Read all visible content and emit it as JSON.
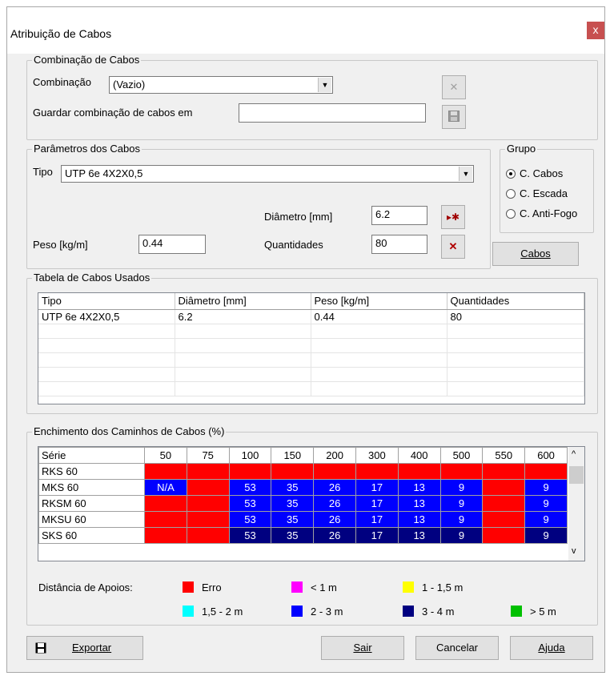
{
  "window": {
    "title": "Atribuição de Cabos",
    "close_glyph": "x"
  },
  "combination_group": {
    "title": "Combinação de Cabos",
    "combination_label": "Combinação",
    "combination_value": "(Vazio)",
    "save_label": "Guardar combinação de cabos em",
    "save_value": ""
  },
  "params_group": {
    "title": "Parâmetros dos Cabos",
    "type_label": "Tipo",
    "type_value": "UTP 6e 4X2X0,5",
    "diameter_label": "Diâmetro [mm]",
    "diameter_value": "6.2",
    "weight_label": "Peso [kg/m]",
    "weight_value": "0.44",
    "quantity_label": "Quantidades",
    "quantity_value": "80"
  },
  "group_box": {
    "title": "Grupo",
    "options": [
      "C. Cabos",
      "C. Escada",
      "C. Anti-Fogo"
    ],
    "selected": "C. Cabos",
    "cabos_button": "Cabos"
  },
  "used_table": {
    "title": "Tabela de Cabos Usados",
    "headers": [
      "Tipo",
      "Diâmetro [mm]",
      "Peso [kg/m]",
      "Quantidades"
    ],
    "rows": [
      [
        "UTP 6e 4X2X0,5",
        "6.2",
        "0.44",
        "80"
      ]
    ]
  },
  "fill_table": {
    "title": "Enchimento dos Caminhos de Cabos (%)",
    "headers": [
      "Série",
      "50",
      "75",
      "100",
      "150",
      "200",
      "300",
      "400",
      "500",
      "550",
      "600"
    ],
    "rows": [
      {
        "name": "RKS 60",
        "cells": [
          [
            "",
            "red"
          ],
          [
            "",
            "red"
          ],
          [
            "",
            "red"
          ],
          [
            "",
            "red"
          ],
          [
            "",
            "red"
          ],
          [
            "",
            "red"
          ],
          [
            "",
            "red"
          ],
          [
            "",
            "red"
          ],
          [
            "",
            "red"
          ],
          [
            "",
            "red"
          ]
        ]
      },
      {
        "name": "MKS 60",
        "cells": [
          [
            "N/A",
            "blue"
          ],
          [
            "",
            "red"
          ],
          [
            "53",
            "blue"
          ],
          [
            "35",
            "blue"
          ],
          [
            "26",
            "blue"
          ],
          [
            "17",
            "blue"
          ],
          [
            "13",
            "blue"
          ],
          [
            "9",
            "blue"
          ],
          [
            "",
            "red"
          ],
          [
            "9",
            "blue"
          ]
        ]
      },
      {
        "name": "RKSM 60",
        "cells": [
          [
            "",
            "red"
          ],
          [
            "",
            "red"
          ],
          [
            "53",
            "blue"
          ],
          [
            "35",
            "blue"
          ],
          [
            "26",
            "blue"
          ],
          [
            "17",
            "blue"
          ],
          [
            "13",
            "blue"
          ],
          [
            "9",
            "blue"
          ],
          [
            "",
            "red"
          ],
          [
            "9",
            "blue"
          ]
        ]
      },
      {
        "name": "MKSU 60",
        "cells": [
          [
            "",
            "red"
          ],
          [
            "",
            "red"
          ],
          [
            "53",
            "blue"
          ],
          [
            "35",
            "blue"
          ],
          [
            "26",
            "blue"
          ],
          [
            "17",
            "blue"
          ],
          [
            "13",
            "blue"
          ],
          [
            "9",
            "blue"
          ],
          [
            "",
            "red"
          ],
          [
            "9",
            "blue"
          ]
        ]
      },
      {
        "name": "SKS 60",
        "cells": [
          [
            "",
            "red"
          ],
          [
            "",
            "red"
          ],
          [
            "53",
            "navy"
          ],
          [
            "35",
            "navy"
          ],
          [
            "26",
            "navy"
          ],
          [
            "17",
            "navy"
          ],
          [
            "13",
            "navy"
          ],
          [
            "9",
            "navy"
          ],
          [
            "",
            "red"
          ],
          [
            "9",
            "navy"
          ]
        ]
      }
    ]
  },
  "legend": {
    "title": "Distância de Apoios:",
    "items": [
      {
        "label": "Erro",
        "color": "#ff0000"
      },
      {
        "label": "< 1 m",
        "color": "#ff00ff"
      },
      {
        "label": "1 - 1,5 m",
        "color": "#ffff00"
      },
      {
        "label": "1,5 - 2 m",
        "color": "#00ffff"
      },
      {
        "label": "2 - 3 m",
        "color": "#0000ff"
      },
      {
        "label": "3 - 4 m",
        "color": "#000080"
      },
      {
        "label": "> 5 m",
        "color": "#00c000"
      }
    ]
  },
  "colors": {
    "red": "#ff0000",
    "blue": "#0000ff",
    "navy": "#000080"
  },
  "buttons": {
    "export": "Exportar",
    "exit": "Sair",
    "cancel": "Cancelar",
    "help": "Ajuda"
  }
}
